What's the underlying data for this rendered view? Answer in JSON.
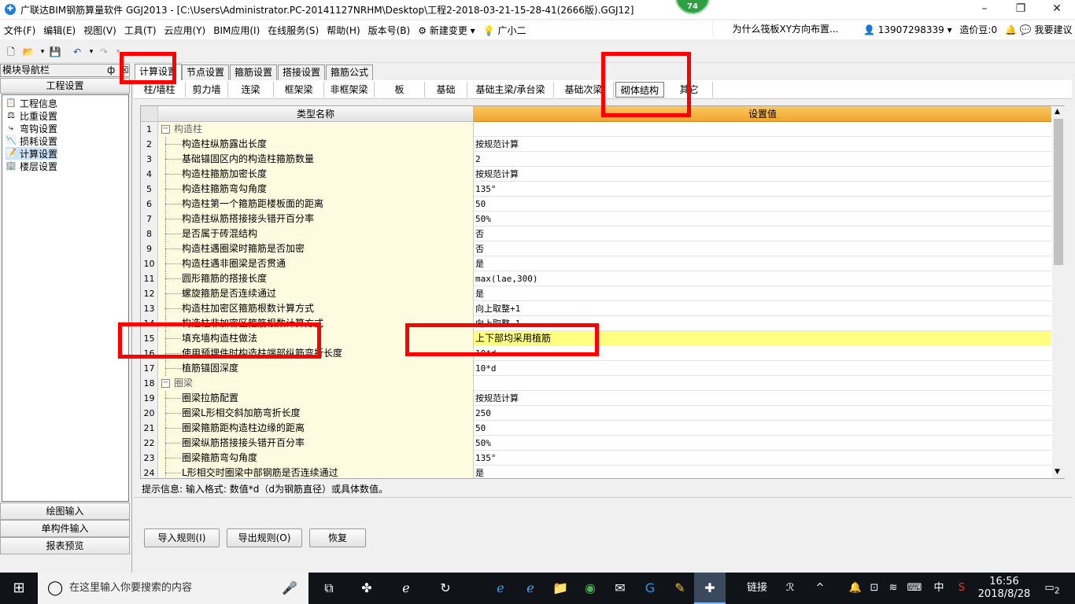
{
  "title_bar": {
    "title": "广联达BIM钢筋算量软件 GGJ2013 - [C:\\Users\\Administrator.PC-20141127NRHM\\Desktop\\工程2-2018-03-21-15-28-41(2666版).GGJ12]",
    "badge": "74",
    "minimize": "–",
    "restore": "❐",
    "close": "✕"
  },
  "menu": {
    "items": [
      "文件(F)",
      "编辑(E)",
      "视图(V)",
      "工具(T)",
      "云应用(Y)",
      "BIM应用(I)",
      "在线服务(S)",
      "帮助(H)",
      "版本号(B)"
    ],
    "new_change": "新建变更",
    "guangxiaoer": "广小二",
    "notice": "为什么筏板XY方向布置...",
    "phone": "13907298339",
    "zaojiadou": "造价豆:0",
    "suggest": "我要建议"
  },
  "nav": {
    "header": "模块导航栏",
    "pin": "ф",
    "title": "工程设置",
    "items": [
      {
        "label": "工程信息",
        "icon": "📋"
      },
      {
        "label": "比重设置",
        "icon": "⚖"
      },
      {
        "label": "弯钩设置",
        "icon": "⤷"
      },
      {
        "label": "损耗设置",
        "icon": "📉"
      },
      {
        "label": "计算设置",
        "icon": "📝"
      },
      {
        "label": "楼层设置",
        "icon": "🏢"
      }
    ],
    "bottom": [
      "绘图输入",
      "单构件输入",
      "报表预览"
    ]
  },
  "tabs1": [
    "计算设置",
    "节点设置",
    "箍筋设置",
    "搭接设置",
    "箍筋公式"
  ],
  "tabs2": [
    "柱/墙柱",
    "剪力墙",
    "连梁",
    "框架梁",
    "非框架梁",
    "板",
    "基础",
    "基础主梁/承台梁",
    "基础次梁",
    "砌体结构",
    "其它"
  ],
  "grid": {
    "col_name": "类型名称",
    "col_value": "设置值",
    "rows": [
      {
        "n": "1",
        "name": "构造柱",
        "value": "",
        "group": true
      },
      {
        "n": "2",
        "name": "构造柱纵筋露出长度",
        "value": "按规范计算"
      },
      {
        "n": "3",
        "name": "基础锚固区内的构造柱箍筋数量",
        "value": "2"
      },
      {
        "n": "4",
        "name": "构造柱箍筋加密长度",
        "value": "按规范计算"
      },
      {
        "n": "5",
        "name": "构造柱箍筋弯勾角度",
        "value": "135°"
      },
      {
        "n": "6",
        "name": "构造柱第一个箍筋距楼板面的距离",
        "value": "50"
      },
      {
        "n": "7",
        "name": "构造柱纵筋搭接接头错开百分率",
        "value": "50%"
      },
      {
        "n": "8",
        "name": "是否属于砖混结构",
        "value": "否"
      },
      {
        "n": "9",
        "name": "构造柱遇圈梁时箍筋是否加密",
        "value": "否"
      },
      {
        "n": "10",
        "name": "构造柱遇非圈梁是否贯通",
        "value": "是"
      },
      {
        "n": "11",
        "name": "圆形箍筋的搭接长度",
        "value": "max(lae,300)"
      },
      {
        "n": "12",
        "name": "螺旋箍筋是否连续通过",
        "value": "是"
      },
      {
        "n": "13",
        "name": "构造柱加密区箍筋根数计算方式",
        "value": "向上取整+1"
      },
      {
        "n": "14",
        "name": "构造柱非加密区箍筋根数计算方式",
        "value": "向上取整-1"
      },
      {
        "n": "15",
        "name": "填充墙构造柱做法",
        "value": "上下部均采用植筋",
        "highlight": true
      },
      {
        "n": "16",
        "name": "使用预埋件时构造柱端部纵筋弯折长度",
        "value": "10*d"
      },
      {
        "n": "17",
        "name": "植筋锚固深度",
        "value": "10*d"
      },
      {
        "n": "18",
        "name": "圈梁",
        "value": "",
        "group": true
      },
      {
        "n": "19",
        "name": "圈梁拉筋配置",
        "value": "按规范计算"
      },
      {
        "n": "20",
        "name": "圈梁L形相交斜加筋弯折长度",
        "value": "250"
      },
      {
        "n": "21",
        "name": "圈梁箍筋距构造柱边缘的距离",
        "value": "50"
      },
      {
        "n": "22",
        "name": "圈梁纵筋搭接接头错开百分率",
        "value": "50%"
      },
      {
        "n": "23",
        "name": "圈梁箍筋弯勾角度",
        "value": "135°"
      },
      {
        "n": "24",
        "name": "L形相交时圈梁中部钢筋是否连续通过",
        "value": "是"
      }
    ]
  },
  "hint": "提示信息: 输入格式: 数值*d（d为钢筋直径）或具体数值。",
  "buttons": {
    "import": "导入规则(I)",
    "export": "导出规则(O)",
    "restore": "恢复"
  },
  "taskbar": {
    "search": "在这里输入你要搜索的内容",
    "link": "链接",
    "ime": "中",
    "time": "16:56",
    "date": "2018/8/28",
    "notif": "2"
  },
  "colors": {
    "header_orange": "#f5b53f",
    "highlight_yellow": "#ffff80",
    "name_bg": "#fdfbe0",
    "annotation_red": "#ff0000"
  }
}
